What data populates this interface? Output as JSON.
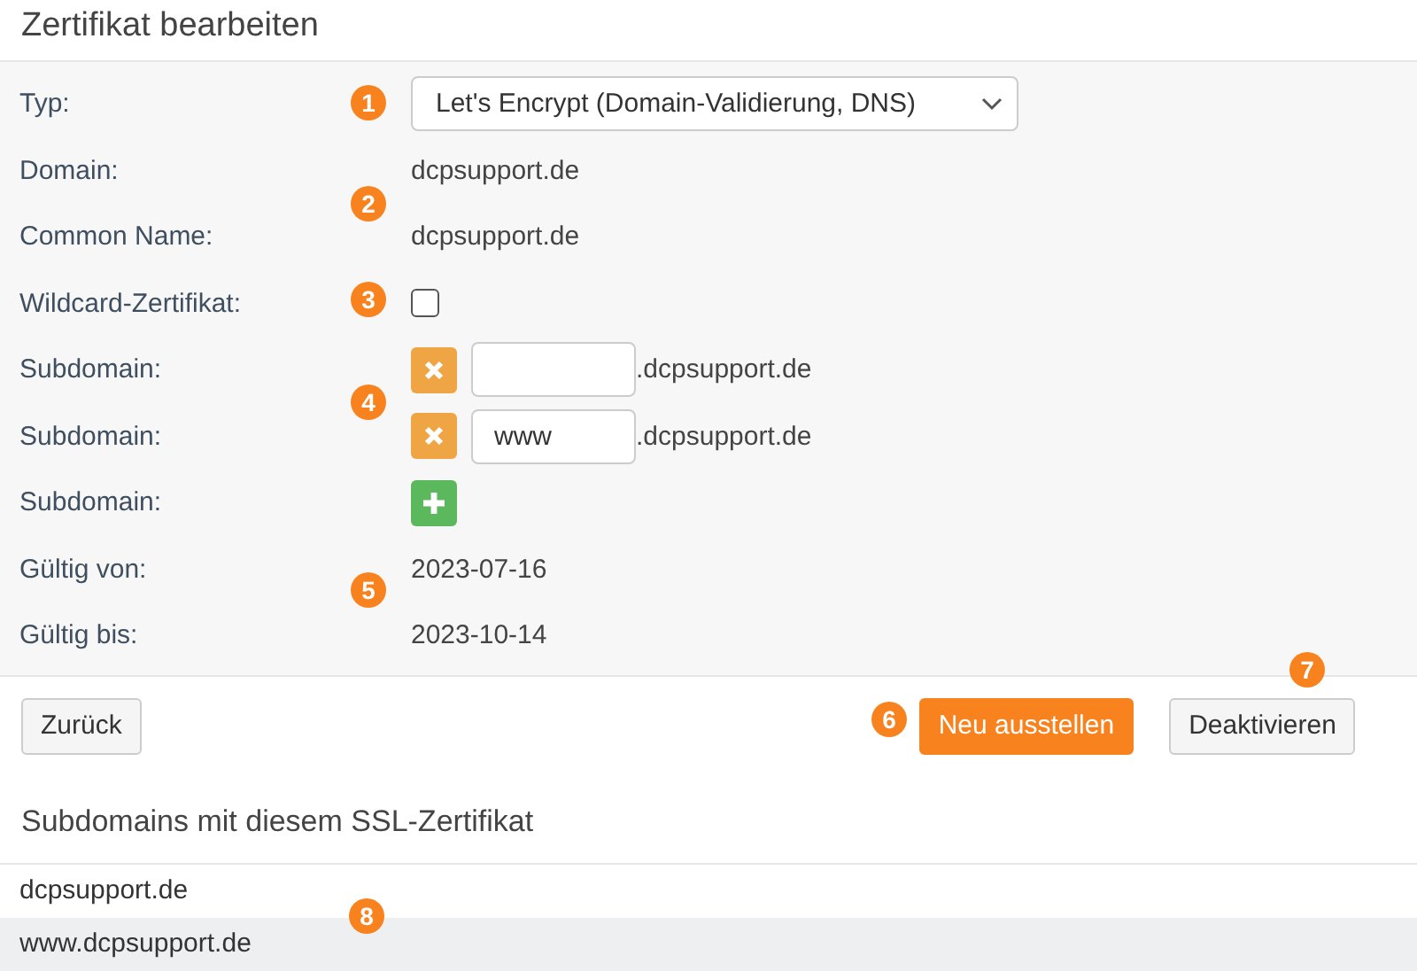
{
  "title": "Zertifikat bearbeiten",
  "form": [
    {
      "kind": "select",
      "label": "Typ:",
      "value": "Let's Encrypt (Domain-Validierung, DNS)"
    },
    {
      "kind": "text",
      "label": "Domain:",
      "value": "dcpsupport.de"
    },
    {
      "kind": "text",
      "label": "Common Name:",
      "value": "dcpsupport.de"
    },
    {
      "kind": "checkbox",
      "label": "Wildcard-Zertifikat:",
      "checked": false
    },
    {
      "kind": "subdomain",
      "label": "Subdomain:",
      "suffix": ".dcpsupport.de"
    },
    {
      "kind": "subdomain",
      "label": "Subdomain:",
      "value": "www",
      "suffix": ".dcpsupport.de"
    },
    {
      "kind": "add",
      "label": "Subdomain:"
    },
    {
      "kind": "text",
      "label": "Gültig von:",
      "value": "2023-07-16"
    },
    {
      "kind": "text",
      "label": "Gültig bis:",
      "value": "2023-10-14"
    }
  ],
  "buttons": [
    {
      "label": "Zurück",
      "kind": "default"
    },
    {
      "label": "Neu ausstellen",
      "kind": "primary"
    },
    {
      "label": "Deaktivieren",
      "kind": "default"
    }
  ],
  "subdomains_title": "Subdomains mit diesem SSL-Zertifikat",
  "subdomains": [
    "dcpsupport.de",
    "www.dcpsupport.de"
  ],
  "markers": [
    "1",
    "2",
    "3",
    "4",
    "5",
    "6",
    "7",
    "8"
  ]
}
